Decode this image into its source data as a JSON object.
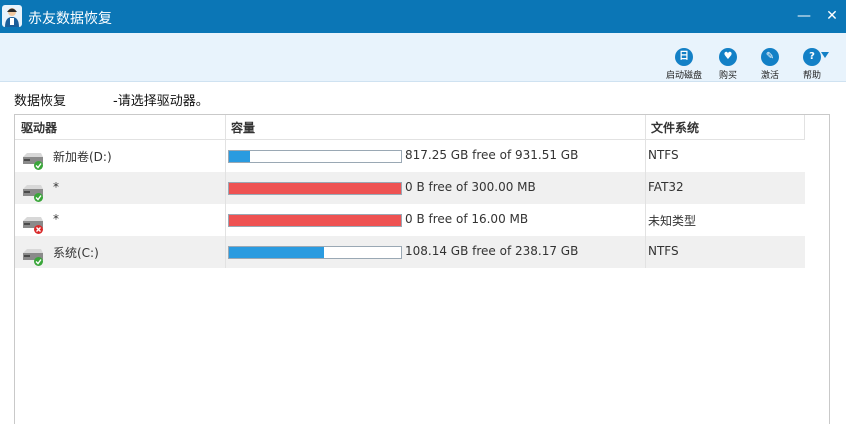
{
  "window": {
    "title": "赤友数据恢复",
    "minimize_glyph": "—",
    "close_glyph": "✕"
  },
  "toolbar": {
    "items": [
      {
        "label": "启动磁盘",
        "icon": "boot-disk-icon",
        "glyph": "日"
      },
      {
        "label": "购买",
        "icon": "cart-icon",
        "glyph": "♥"
      },
      {
        "label": "激活",
        "icon": "key-icon",
        "glyph": "✎"
      },
      {
        "label": "帮助",
        "icon": "help-icon",
        "glyph": "?"
      }
    ]
  },
  "breadcrumb": {
    "section": "数据恢复",
    "hint": "-请选择驱动器。"
  },
  "table": {
    "headers": {
      "drive": "驱动器",
      "capacity": "容量",
      "filesystem": "文件系统"
    },
    "rows": [
      {
        "name": "新加卷(D:)",
        "status": "ok",
        "used_fraction": 0.12,
        "bar_color": "#2a9be0",
        "capacity": "817.25 GB free of 931.51 GB",
        "fs": "NTFS"
      },
      {
        "name": "*",
        "status": "ok",
        "used_fraction": 1.0,
        "bar_color": "#ee5252",
        "capacity": "0 B free of 300.00 MB",
        "fs": "FAT32"
      },
      {
        "name": "*",
        "status": "error",
        "used_fraction": 1.0,
        "bar_color": "#ee5252",
        "capacity": "0 B free of 16.00 MB",
        "fs": "未知类型"
      },
      {
        "name": "系统(C:)",
        "status": "ok",
        "used_fraction": 0.55,
        "bar_color": "#2a9be0",
        "capacity": "108.14 GB free of 238.17 GB",
        "fs": "NTFS"
      }
    ]
  },
  "colors": {
    "titlebar": "#0b76b6",
    "toolbar_bg": "#e8f3fc",
    "status_ok": "#3aa63a",
    "status_error": "#d92b2b"
  }
}
